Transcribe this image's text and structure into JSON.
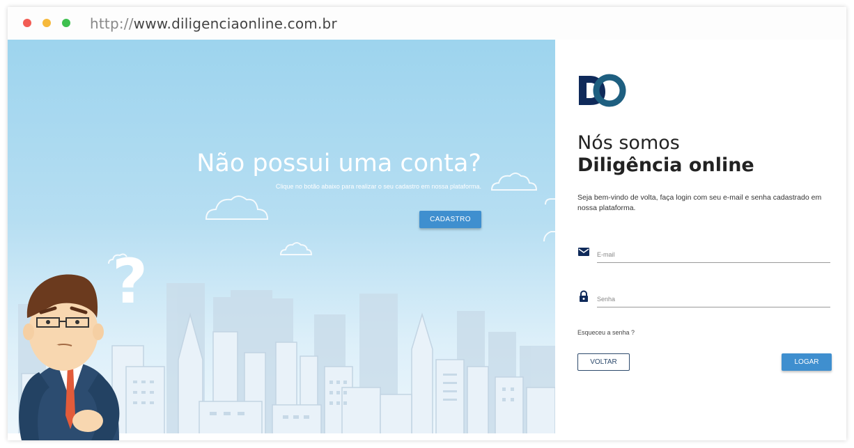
{
  "browser": {
    "url_protocol": "http://",
    "url_host": "www.diligenciaonline.com.br"
  },
  "left_panel": {
    "headline": "Não possui uma conta?",
    "subline": "Clique no botão abaixo para realizar o seu cadastro em nossa plataforma.",
    "signup_button": "CADASTRO",
    "question_mark": "?"
  },
  "login": {
    "logo_text": "DO",
    "title_line1": "Nós somos",
    "title_line2": "Diligência online",
    "welcome_text": "Seja bem-vindo de volta, faça login com seu e-mail e senha cadastrado em nossa plataforma.",
    "email_placeholder": "E-mail",
    "password_placeholder": "Senha",
    "forgot_password": "Esqueceu a senha ?",
    "back_button": "VOLTAR",
    "login_button": "LOGAR"
  },
  "colors": {
    "primary_button": "#3f8fcf",
    "logo_dark": "#0f2a5a",
    "logo_teal": "#1e5f80"
  },
  "icons": [
    "mail-icon",
    "lock-icon"
  ]
}
